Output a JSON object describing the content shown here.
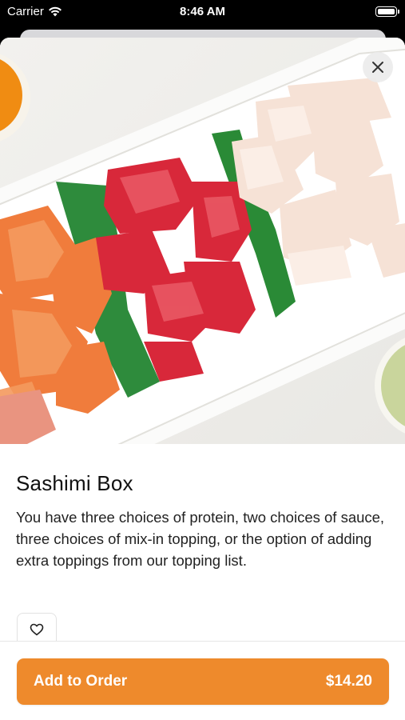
{
  "status_bar": {
    "carrier": "Carrier",
    "time": "8:46 AM",
    "wifi_icon": "wifi-icon",
    "battery_icon": "battery-icon"
  },
  "item": {
    "image_description_icon": "food-photo",
    "name": "Sashimi Box",
    "description": "You have three choices of protein, two choices of sauce, three choices of mix-in topping, or the option of adding extra toppings from our topping list."
  },
  "actions": {
    "close_icon": "close-icon",
    "favorite_icon": "heart-icon",
    "add_label": "Add to Order",
    "price": "$14.20"
  },
  "colors": {
    "accent": "#ee8a2c",
    "text": "#222222"
  }
}
